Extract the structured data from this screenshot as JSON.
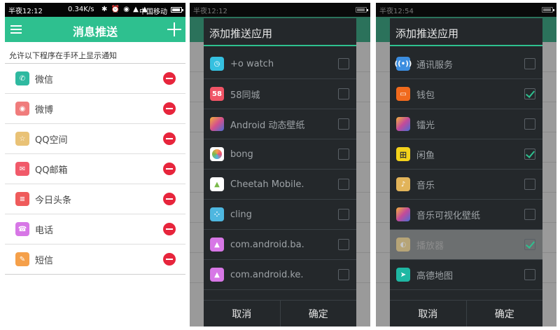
{
  "status_bar": {
    "time_1": "半夜12:12",
    "speed": "0.34K/s",
    "icons": "✱ ⏰ ◉ ▲ ▲",
    "carrier": "中国移动",
    "time_2": "半夜12:12",
    "time_3": "半夜12:54"
  },
  "screen1": {
    "title": "消息推送",
    "caption": "允许以下程序在手环上显示通知",
    "apps": [
      {
        "name": "微信",
        "icon": "wechat-icon",
        "color": "#2fb9a0"
      },
      {
        "name": "微博",
        "icon": "weibo-icon",
        "color": "#f07c7c"
      },
      {
        "name": "QQ空间",
        "icon": "qzone-icon",
        "color": "#e9c276"
      },
      {
        "name": "QQ邮箱",
        "icon": "qqmail-icon",
        "color": "#f15a6a"
      },
      {
        "name": "今日头条",
        "icon": "toutiao-icon",
        "color": "#ef5b5b"
      },
      {
        "name": "电话",
        "icon": "phone-icon",
        "color": "#d777e6"
      },
      {
        "name": "短信",
        "icon": "sms-icon",
        "color": "#f5a04a"
      }
    ]
  },
  "dialog": {
    "title": "添加推送应用",
    "cancel": "取消",
    "confirm": "确定"
  },
  "screen2": {
    "apps": [
      {
        "name": "+o watch",
        "checked": false,
        "color": "#35c0e0"
      },
      {
        "name": "58同城",
        "checked": false,
        "color": "#f05466",
        "glyph": "58"
      },
      {
        "name": "Android 动态壁纸",
        "checked": false,
        "color": "#d4508c"
      },
      {
        "name": "bong",
        "checked": false,
        "color": "#f6a24d"
      },
      {
        "name": "Cheetah Mobile.",
        "checked": false,
        "color": "#7ab94a"
      },
      {
        "name": "cling",
        "checked": false,
        "color": "#4eb7e0"
      },
      {
        "name": "com.android.ba.",
        "checked": false,
        "color": "#d777e6"
      },
      {
        "name": "com.android.ke.",
        "checked": false,
        "color": "#d777e6"
      }
    ]
  },
  "screen3": {
    "apps": [
      {
        "name": "通讯服务",
        "checked": false,
        "color": "#3c8ee0"
      },
      {
        "name": "钱包",
        "checked": true,
        "color": "#f06a1d"
      },
      {
        "name": "镭光",
        "checked": false,
        "color": "#c34a9a"
      },
      {
        "name": "闲鱼",
        "checked": true,
        "color": "#f3d21b",
        "glyph": "田"
      },
      {
        "name": "音乐",
        "checked": false,
        "color": "#e2b45a"
      },
      {
        "name": "音乐可视化壁纸",
        "checked": false,
        "color": "#c34a9a"
      },
      {
        "name": "播放器",
        "checked": true,
        "color": "#e8c87c",
        "pressed": true
      },
      {
        "name": "高德地图",
        "checked": false,
        "color": "#1fb7a3"
      }
    ]
  }
}
